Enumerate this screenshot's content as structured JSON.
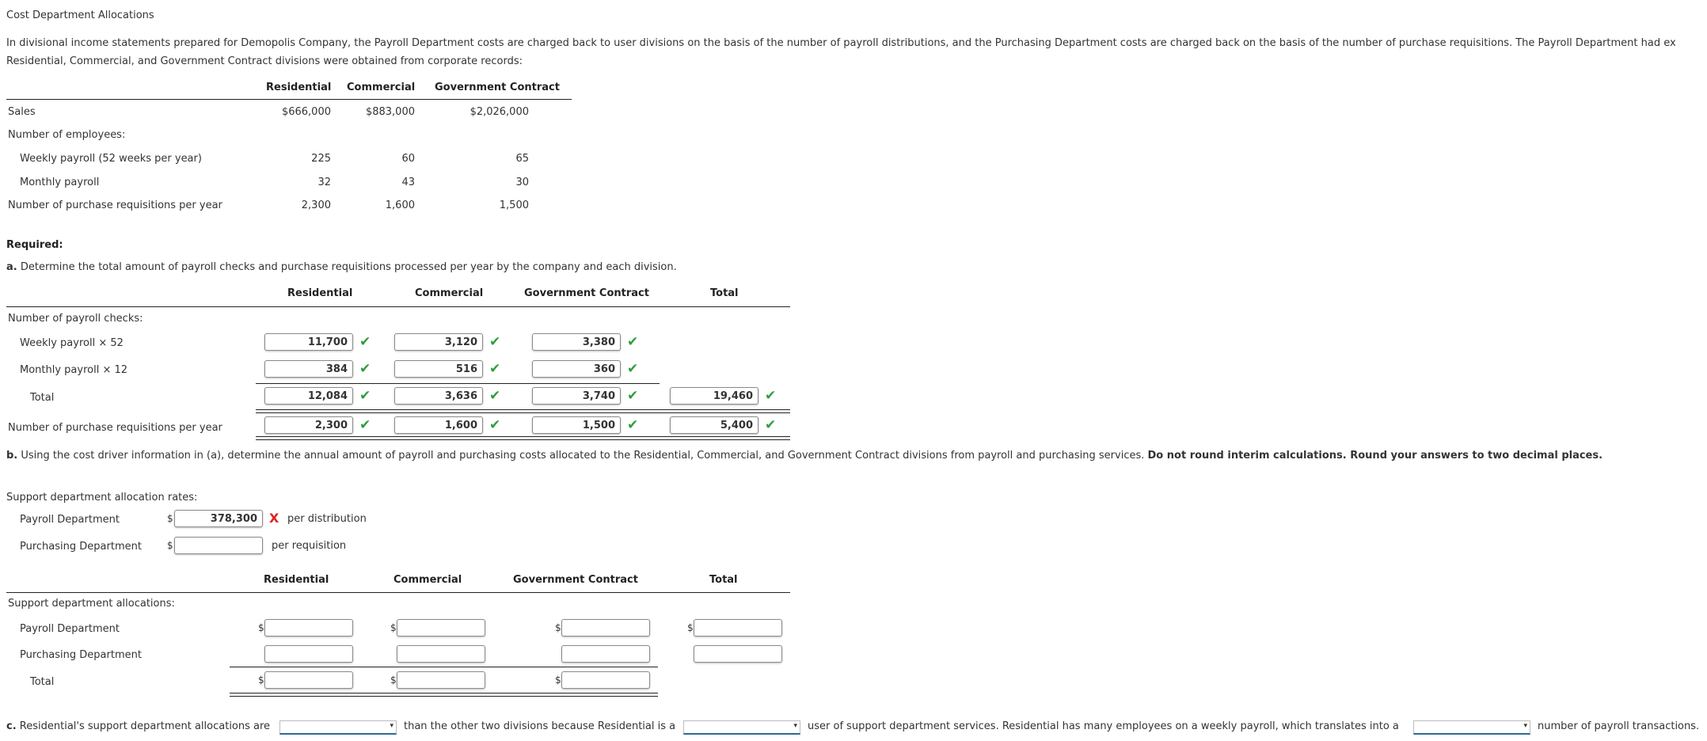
{
  "title": "Cost Department Allocations",
  "intro": {
    "line1": "In divisional income statements prepared for Demopolis Company, the Payroll Department costs are charged back to user divisions on the basis of the number of payroll distributions, and the Purchasing Department costs are charged back on the basis of the number of purchase requisitions. The Payroll Department had ex",
    "line2": "Residential, Commercial, and Government Contract divisions were obtained from corporate records:"
  },
  "records_table": {
    "headers": [
      "Residential",
      "Commercial",
      "Government Contract"
    ],
    "rows": [
      {
        "label": "Sales",
        "values": [
          "$666,000",
          "$883,000",
          "$2,026,000"
        ]
      },
      {
        "label": "Number of employees:",
        "values": [
          "",
          "",
          ""
        ]
      },
      {
        "label": "Weekly payroll (52 weeks per year)",
        "values": [
          "225",
          "60",
          "65"
        ]
      },
      {
        "label": "Monthly payroll",
        "values": [
          "32",
          "43",
          "30"
        ]
      },
      {
        "label": "Number of purchase requisitions per year",
        "values": [
          "2,300",
          "1,600",
          "1,500"
        ]
      }
    ]
  },
  "required": {
    "heading": "Required:",
    "part_a": {
      "letter": "a.",
      "text": "Determine the total amount of payroll checks and purchase requisitions processed per year by the company and each division."
    },
    "part_b": {
      "letter": "b.",
      "text": "Using the cost driver information in (a), determine the annual amount of payroll and purchasing costs allocated to the Residential, Commercial, and Government Contract divisions from payroll and purchasing services. ",
      "bold_text": "Do not round interim calculations. Round your answers to two decimal places."
    },
    "part_c": {
      "letter": "c.",
      "text1": "Residential's support department allocations are",
      "text2": "than the other two divisions because Residential is a",
      "text3": "user of support department services. Residential has many employees on a weekly payroll, which translates into a",
      "text4": "number of payroll transactions.",
      "dropdowns": [
        "",
        "",
        ""
      ]
    }
  },
  "table_a": {
    "headers": [
      "Residential",
      "Commercial",
      "Government Contract",
      "Total"
    ],
    "section_label": "Number of payroll checks:",
    "rows": [
      {
        "label": "Weekly payroll × 52",
        "values": [
          "11,700",
          "3,120",
          "3,380"
        ],
        "status": [
          "correct",
          "correct",
          "correct"
        ]
      },
      {
        "label": "Monthly payroll × 12",
        "values": [
          "384",
          "516",
          "360"
        ],
        "status": [
          "correct",
          "correct",
          "correct"
        ]
      },
      {
        "label": "Total",
        "values": [
          "12,084",
          "3,636",
          "3,740",
          "19,460"
        ],
        "status": [
          "correct",
          "correct",
          "correct",
          "correct"
        ]
      },
      {
        "label": "Number of purchase requisitions per year",
        "values": [
          "2,300",
          "1,600",
          "1,500",
          "5,400"
        ],
        "status": [
          "correct",
          "correct",
          "correct",
          "correct"
        ]
      }
    ]
  },
  "rates": {
    "heading": "Support department allocation rates:",
    "currency": "$",
    "payroll": {
      "label": "Payroll Department",
      "value": "378,300",
      "status": "incorrect",
      "unit": "per distribution"
    },
    "purchasing": {
      "label": "Purchasing Department",
      "value": "",
      "unit": "per requisition"
    }
  },
  "table_b": {
    "headers": [
      "Residential",
      "Commercial",
      "Government Contract",
      "Total"
    ],
    "section_label": "Support department allocations:",
    "currency": "$",
    "rows": [
      {
        "label": "Payroll Department",
        "values": [
          "",
          "",
          "",
          ""
        ]
      },
      {
        "label": "Purchasing Department",
        "values": [
          "",
          "",
          "",
          ""
        ]
      },
      {
        "label": "Total",
        "values": [
          "",
          "",
          ""
        ]
      }
    ]
  },
  "icons": {
    "correct": "✔",
    "incorrect": "X",
    "dropdown": "▾"
  },
  "colors": {
    "correct": "#2e9e3e",
    "incorrect": "#e02020",
    "dropdown_underline": "#2d6a96"
  }
}
